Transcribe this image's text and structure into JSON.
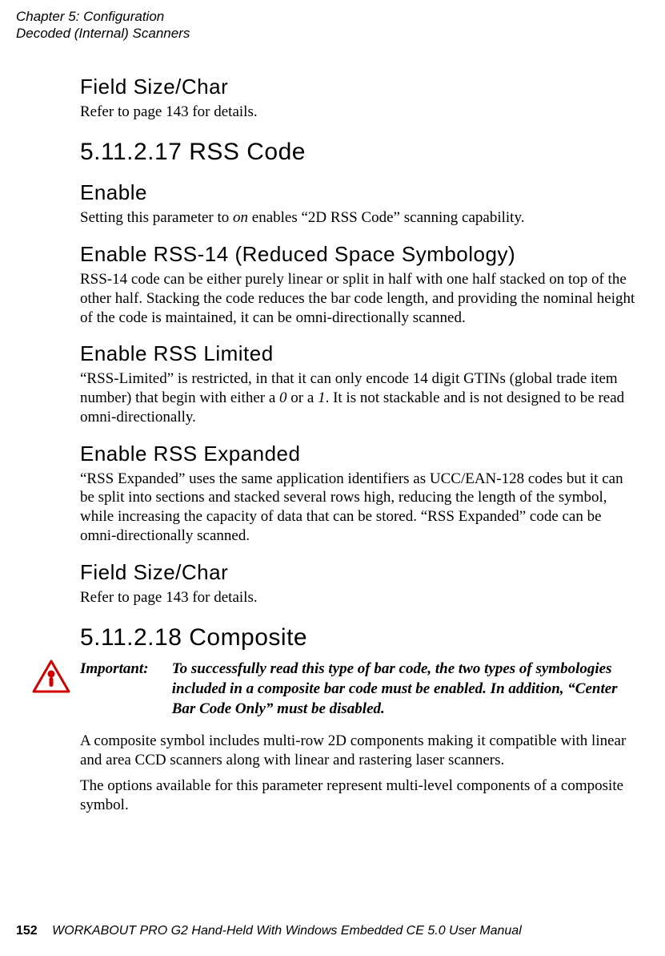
{
  "runningHead": {
    "line1": "Chapter 5: Configuration",
    "line2": "Decoded (Internal) Scanners"
  },
  "sections": {
    "fieldSizeChar1": {
      "title": "Field Size/Char",
      "body": "Refer to page 143 for details."
    },
    "rssCode": {
      "title": "5.11.2.17 RSS Code"
    },
    "enable": {
      "title": "Enable",
      "body_pre": "Setting this parameter to ",
      "body_em": "on",
      "body_post": " enables “2D RSS Code” scanning capability."
    },
    "rss14": {
      "title": "Enable RSS-14 (Reduced Space Symbology)",
      "body": "RSS-14 code can be either purely linear or split in half with one half stacked on top of the other half. Stacking the code reduces the bar code length, and providing the nominal height of the code is maintained, it can be omni-directionally scanned."
    },
    "rssLimited": {
      "title": "Enable RSS Limited",
      "body_pre": "“RSS-Limited” is restricted, in that it can only encode 14 digit GTINs (global trade item number) that begin with either a ",
      "body_em1": "0",
      "body_mid": " or a ",
      "body_em2": "1",
      "body_post": ". It is not stackable and is not designed to be read omni-directionally."
    },
    "rssExpanded": {
      "title": "Enable RSS Expanded",
      "body": "“RSS Expanded” uses the same application identifiers as UCC/EAN-128 codes but it can be split into sections and stacked several rows high, reducing the length of the symbol, while increasing the capacity of data that can be stored. “RSS Expanded” code can be omni-directionally scanned."
    },
    "fieldSizeChar2": {
      "title": "Field Size/Char",
      "body": "Refer to page 143 for details."
    },
    "composite": {
      "title": "5.11.2.18 Composite",
      "important_label": "Important:",
      "important_msg": "To successfully read this type of bar code, the two types of symbologies included in a composite bar code must be enabled. In addition, “Center Bar Code Only” must be disabled.",
      "p1": "A composite symbol includes multi-row 2D components making it compatible with linear and area CCD scanners along with linear and rastering laser scanners.",
      "p2": "The options available for this parameter represent multi-level components of a composite symbol."
    }
  },
  "footer": {
    "pageNumber": "152",
    "text": "WORKABOUT PRO G2 Hand-Held With Windows Embedded CE 5.0 User Manual"
  }
}
